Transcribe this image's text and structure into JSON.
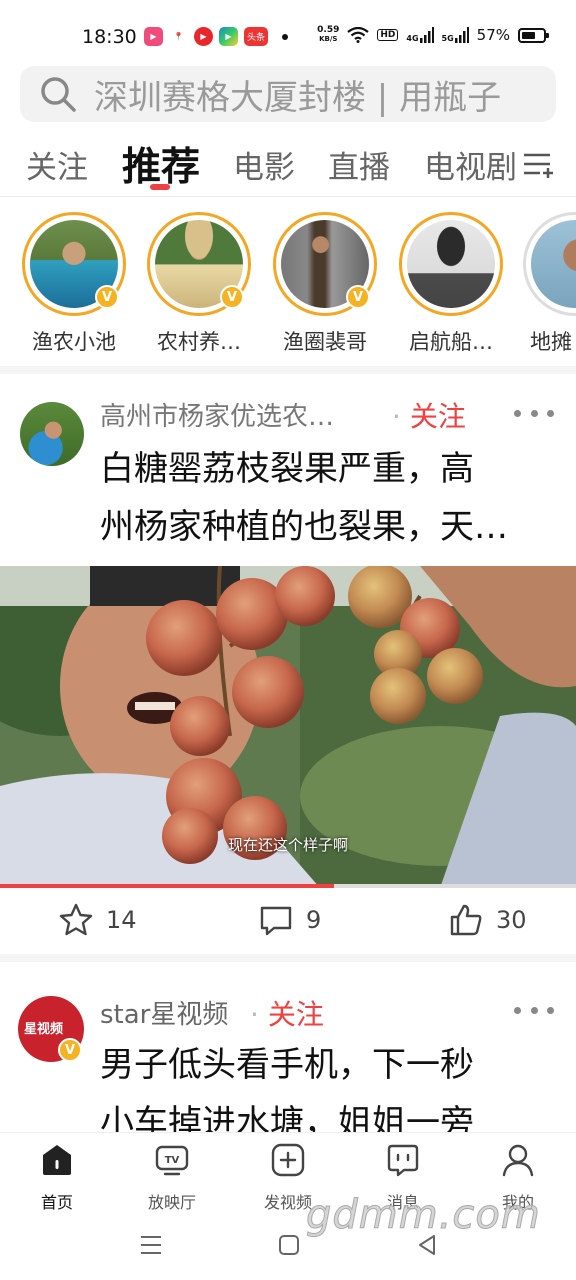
{
  "status_bar": {
    "time": "18:30",
    "app_badge": "头条",
    "net_speed_value": "0.59",
    "net_speed_unit": "KB/S",
    "hd_badge": "HD",
    "net_4g": "4G",
    "net_5g": "5G",
    "battery": "57%"
  },
  "search": {
    "placeholder": "深圳赛格大厦封楼 | 用瓶子"
  },
  "tabs": [
    {
      "label": "关注"
    },
    {
      "label": "推荐"
    },
    {
      "label": "电影"
    },
    {
      "label": "直播"
    },
    {
      "label": "电视剧"
    }
  ],
  "following": [
    {
      "name": "渔农小池",
      "verified": true
    },
    {
      "name": "农村养…",
      "verified": true
    },
    {
      "name": "渔圈裴哥",
      "verified": true
    },
    {
      "name": "启航船…",
      "verified": false
    },
    {
      "name": "地摊",
      "verified": false
    }
  ],
  "post1": {
    "author": "高州市杨家优选农…",
    "follow": "关注",
    "title_line1": "白糖罂荔枝裂果严重，高",
    "title_line2": "州杨家种植的也裂果，天…",
    "subtitle": "现在还这个样子啊",
    "progress": 0.58,
    "favorites": "14",
    "comments": "9",
    "likes": "30"
  },
  "post2": {
    "author": "star星视频",
    "follow": "关注",
    "title_line1": "男子低头看手机，下一秒",
    "title_line2": "小车掉进水塘，姐姐一旁",
    "avatar_text": "星视频"
  },
  "bottom_nav": [
    {
      "label": "首页",
      "icon": "home-icon"
    },
    {
      "label": "放映厅",
      "icon": "tv-icon"
    },
    {
      "label": "发视频",
      "icon": "add-video-icon"
    },
    {
      "label": "消息",
      "icon": "message-icon"
    },
    {
      "label": "我的",
      "icon": "profile-icon"
    }
  ],
  "watermark": "gdmm.com",
  "colors": {
    "accent": "#f04142",
    "badge": "#f5b324"
  }
}
